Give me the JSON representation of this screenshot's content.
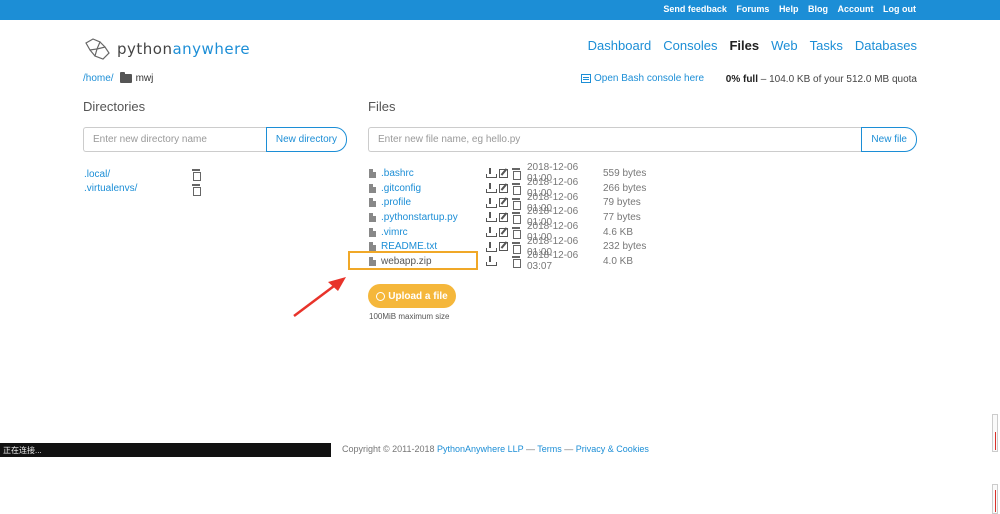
{
  "topbar": {
    "links": [
      "Send feedback",
      "Forums",
      "Help",
      "Blog",
      "Account",
      "Log out"
    ]
  },
  "logo": {
    "part1": "python",
    "part2": "anywhere"
  },
  "nav": {
    "items": [
      "Dashboard",
      "Consoles",
      "Files",
      "Web",
      "Tasks",
      "Databases"
    ],
    "active": "Files"
  },
  "breadcrumb": {
    "root": "/home/",
    "current": "mwj"
  },
  "bash_link": "Open Bash console here",
  "quota": {
    "full": "0% full",
    "detail": " – 104.0 KB of your 512.0 MB quota"
  },
  "directories": {
    "title": "Directories",
    "placeholder": "Enter new directory name",
    "button": "New directory",
    "items": [
      ".local/",
      ".virtualenvs/"
    ]
  },
  "files": {
    "title": "Files",
    "placeholder": "Enter new file name, eg hello.py",
    "button": "New file",
    "items": [
      {
        "name": ".bashrc",
        "date": "2018-12-06 01:00",
        "size": "559 bytes"
      },
      {
        "name": ".gitconfig",
        "date": "2018-12-06 01:00",
        "size": "266 bytes"
      },
      {
        "name": ".profile",
        "date": "2018-12-06 01:00",
        "size": "79 bytes"
      },
      {
        "name": ".pythonstartup.py",
        "date": "2018-12-06 01:00",
        "size": "77 bytes"
      },
      {
        "name": ".vimrc",
        "date": "2018-12-06 01:00",
        "size": "4.6 KB"
      },
      {
        "name": "README.txt",
        "date": "2018-12-06 01:00",
        "size": "232 bytes"
      },
      {
        "name": "webapp.zip",
        "date": "2018-12-06 03:07",
        "size": "4.0 KB"
      }
    ]
  },
  "upload": {
    "button": "Upload a file",
    "note": "100MiB maximum size"
  },
  "footer": {
    "copyright": "Copyright © 2011-2018 ",
    "company": "PythonAnywhere LLP",
    "sep1": " — ",
    "terms": "Terms",
    "sep2": " — ",
    "privacy": "Privacy & Cookies"
  },
  "status_bar": "正在连接...",
  "colors": {
    "brand": "#1c8ed6",
    "upload": "#f5b73b",
    "highlight": "#f0a828",
    "arrow": "#e8332a"
  }
}
